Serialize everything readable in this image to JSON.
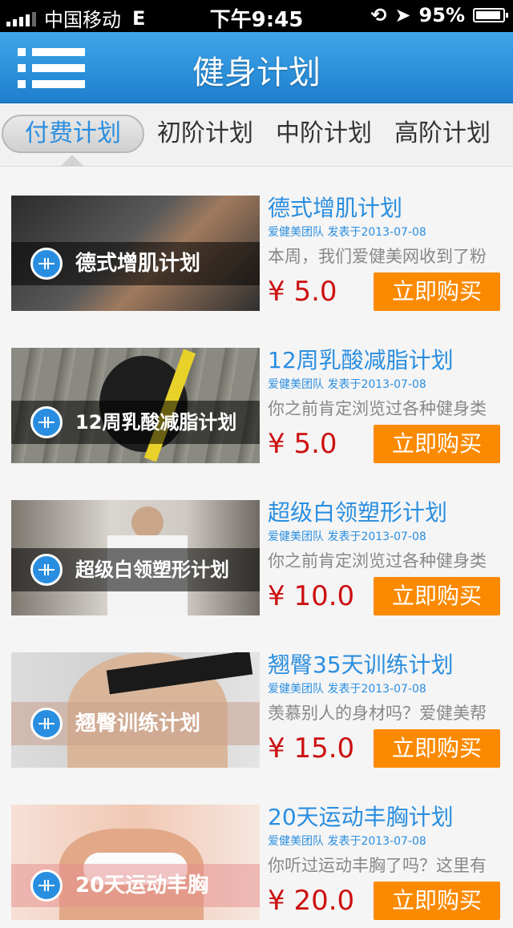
{
  "status_bar": {
    "carrier": "中国移动",
    "network": "E",
    "time": "下午9:45",
    "battery": "95%",
    "battery_level": 0.95
  },
  "nav": {
    "title": "健身计划"
  },
  "tabs": [
    {
      "label": "付费计划",
      "active": true
    },
    {
      "label": "初阶计划",
      "active": false
    },
    {
      "label": "中阶计划",
      "active": false
    },
    {
      "label": "高阶计划",
      "active": false
    }
  ],
  "plans": [
    {
      "thumb_caption": "德式增肌计划",
      "title": "德式增肌计划",
      "meta": "爱健美团队 发表于2013-07-08",
      "desc": "本周，我们爱健美网收到了粉",
      "price": "¥ 5.0",
      "buy_label": "立即购买"
    },
    {
      "thumb_caption": "12周乳酸减脂计划",
      "title": "12周乳酸减脂计划",
      "meta": "爱健美团队 发表于2013-07-08",
      "desc": "你之前肯定浏览过各种健身类",
      "price": "¥ 5.0",
      "buy_label": "立即购买"
    },
    {
      "thumb_caption": "超级白领塑形计划",
      "title": "超级白领塑形计划",
      "meta": "爱健美团队 发表于2013-07-08",
      "desc": "你之前肯定浏览过各种健身类",
      "price": "¥ 10.0",
      "buy_label": "立即购买"
    },
    {
      "thumb_caption": "翘臀训练计划",
      "title": "翘臀35天训练计划",
      "meta": "爱健美团队 发表于2013-07-08",
      "desc": "羡慕别人的身材吗？爱健美帮",
      "price": "¥ 15.0",
      "buy_label": "立即购买"
    },
    {
      "thumb_caption": "20天运动丰胸",
      "title": "20天运动丰胸计划",
      "meta": "爱健美团队 发表于2013-07-08",
      "desc": "你听过运动丰胸了吗？这里有",
      "price": "¥ 20.0",
      "buy_label": "立即购买"
    }
  ],
  "colors": {
    "accent": "#2a8ee0",
    "price": "#cc1111",
    "buy_button": "#fb8a00",
    "nav_top": "#3fa6e8",
    "nav_bottom": "#1e7fcf"
  }
}
